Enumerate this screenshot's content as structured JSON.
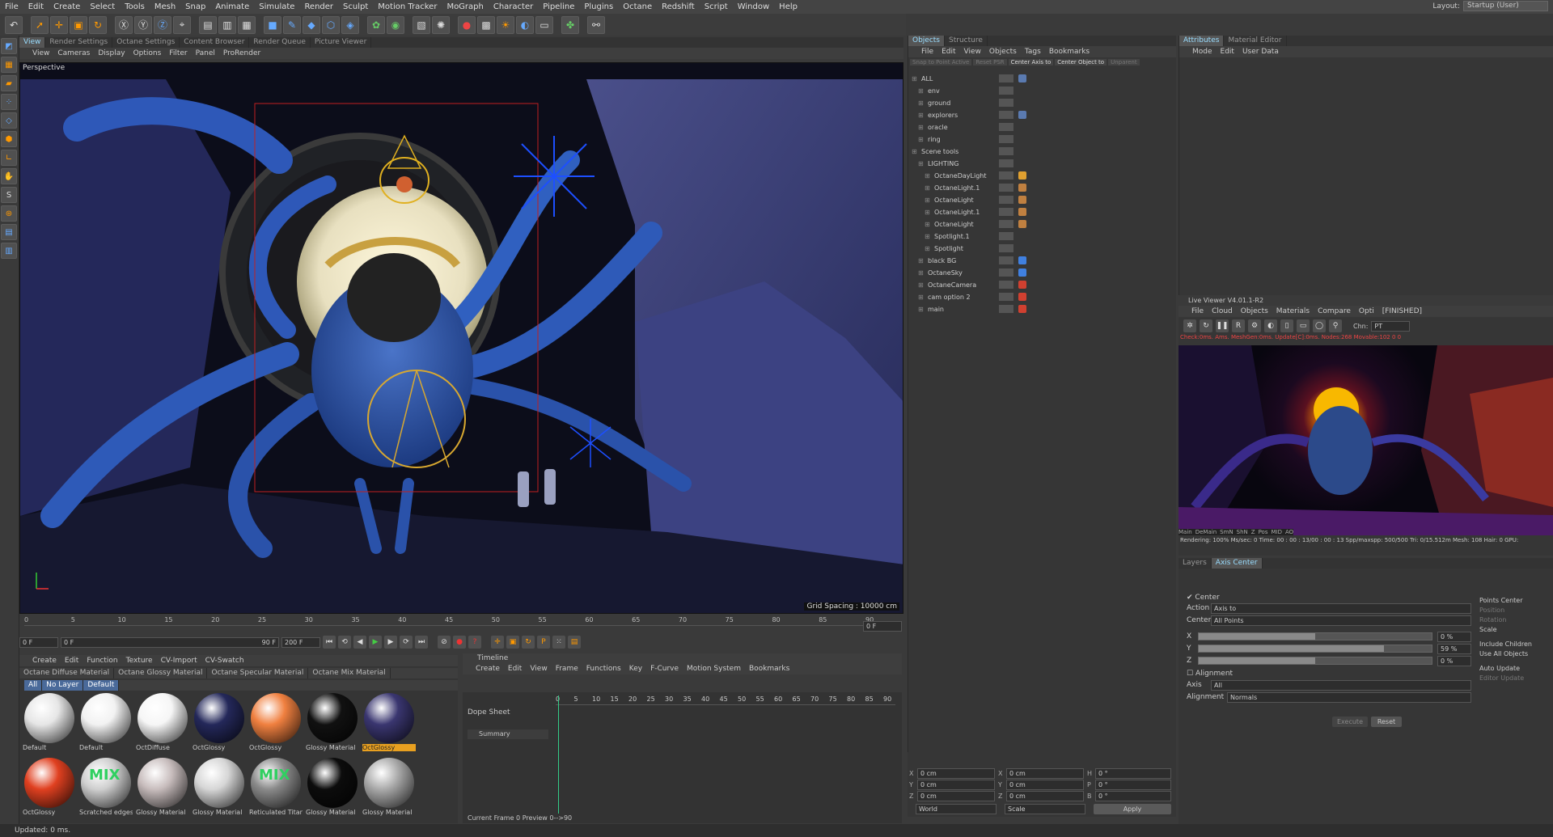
{
  "menu": [
    "File",
    "Edit",
    "Create",
    "Select",
    "Tools",
    "Mesh",
    "Snap",
    "Animate",
    "Simulate",
    "Render",
    "Sculpt",
    "Motion Tracker",
    "MoGraph",
    "Character",
    "Pipeline",
    "Plugins",
    "Octane",
    "Redshift",
    "Script",
    "Window",
    "Help"
  ],
  "layout": {
    "label": "Layout:",
    "value": "Startup (User)"
  },
  "viewport": {
    "tabs": [
      "View",
      "Render Settings",
      "Octane Settings",
      "Content Browser",
      "Render Queue",
      "Picture Viewer"
    ],
    "menu": [
      "View",
      "Cameras",
      "Display",
      "Options",
      "Filter",
      "Panel",
      "ProRender"
    ],
    "label": "Perspective",
    "grid": "Grid Spacing : 10000 cm"
  },
  "timeline": {
    "ticks": [
      "0",
      "5",
      "10",
      "15",
      "20",
      "25",
      "30",
      "35",
      "40",
      "45",
      "50",
      "55",
      "60",
      "65",
      "70",
      "75",
      "80",
      "85",
      "90"
    ],
    "current": "0 F",
    "start": "0 F",
    "preview_start": "0 F",
    "preview_end": "90 F",
    "end": "200 F"
  },
  "materials": {
    "menu": [
      "Create",
      "Edit",
      "Function",
      "Texture",
      "CV-Import",
      "CV-Swatch"
    ],
    "tabs": [
      "Octane Diffuse Material",
      "Octane Glossy Material",
      "Octane Specular Material",
      "Octane Mix Material"
    ],
    "filters": [
      "All",
      "No Layer",
      "Default"
    ],
    "items": [
      {
        "name": "Default",
        "color": "#e6e6e6",
        "mix": ""
      },
      {
        "name": "Default",
        "color": "#f2f2f2",
        "mix": ""
      },
      {
        "name": "OctDiffuse",
        "color": "#f6f6f6",
        "mix": ""
      },
      {
        "name": "OctGlossy",
        "color": "#24285a",
        "mix": ""
      },
      {
        "name": "OctGlossy",
        "color": "#f08040",
        "mix": ""
      },
      {
        "name": "Glossy Material",
        "color": "#111",
        "mix": ""
      },
      {
        "name": "OctGlossy",
        "color": "#3a3670",
        "mix": ""
      },
      {
        "name": "OctGlossy",
        "color": "#e04020",
        "mix": ""
      },
      {
        "name": "Scratched edges",
        "color": "#cfcfcf",
        "mix": "MIX"
      },
      {
        "name": "Glossy Material",
        "color": "#c8bdbd",
        "mix": ""
      },
      {
        "name": "Glossy Material",
        "color": "#d6d6d6",
        "mix": ""
      },
      {
        "name": "Reticulated Titan",
        "color": "#8a8a8a",
        "mix": "MIX"
      },
      {
        "name": "Glossy Material",
        "color": "#0c0c0c",
        "mix": ""
      },
      {
        "name": "Glossy Material",
        "color": "#aaaaaa",
        "mix": ""
      }
    ]
  },
  "dope": {
    "title": "Timeline",
    "menu": [
      "Create",
      "Edit",
      "View",
      "Frame",
      "Functions",
      "Key",
      "F-Curve",
      "Motion System",
      "Bookmarks"
    ],
    "label": "Dope Sheet",
    "summary": "Summary",
    "ticks": [
      "0",
      "5",
      "10",
      "15",
      "20",
      "25",
      "30",
      "35",
      "40",
      "45",
      "50",
      "55",
      "60",
      "65",
      "70",
      "75",
      "80",
      "85",
      "90"
    ],
    "footer": "Current Frame  0  Preview  0-->90"
  },
  "objects": {
    "tabs": [
      "Objects",
      "Structure"
    ],
    "menu": [
      "File",
      "Edit",
      "View",
      "Objects",
      "Tags",
      "Bookmarks"
    ],
    "buttons": [
      "Snap to Point Active",
      "Reset PSR",
      "Center Axis to",
      "Center Object to",
      "Unparent"
    ],
    "rows": [
      {
        "name": "ALL",
        "indent": 0,
        "tag": "#5a7ab0"
      },
      {
        "name": "env",
        "indent": 1,
        "tag": ""
      },
      {
        "name": "ground",
        "indent": 1,
        "tag": ""
      },
      {
        "name": "explorers",
        "indent": 1,
        "tag": "#5a7ab0"
      },
      {
        "name": "oracle",
        "indent": 1,
        "tag": ""
      },
      {
        "name": "ring",
        "indent": 1,
        "tag": ""
      },
      {
        "name": "Scene tools",
        "indent": 0,
        "tag": ""
      },
      {
        "name": "LIGHTING",
        "indent": 1,
        "tag": ""
      },
      {
        "name": "OctaneDayLight",
        "indent": 2,
        "tag": "#e0a030"
      },
      {
        "name": "OctaneLight.1",
        "indent": 2,
        "tag": "#c08040"
      },
      {
        "name": "OctaneLight",
        "indent": 2,
        "tag": "#c08040"
      },
      {
        "name": "OctaneLight.1",
        "indent": 2,
        "tag": "#c08040"
      },
      {
        "name": "OctaneLight",
        "indent": 2,
        "tag": "#c08040"
      },
      {
        "name": "Spotlight.1",
        "indent": 2,
        "tag": ""
      },
      {
        "name": "Spotlight",
        "indent": 2,
        "tag": ""
      },
      {
        "name": "black BG",
        "indent": 1,
        "tag": "#4080e0"
      },
      {
        "name": "OctaneSky",
        "indent": 1,
        "tag": "#4080e0"
      },
      {
        "name": "OctaneCamera",
        "indent": 1,
        "tag": "#d04030"
      },
      {
        "name": "cam option 2",
        "indent": 1,
        "tag": "#d04030"
      },
      {
        "name": "main",
        "indent": 1,
        "tag": "#d04030"
      }
    ]
  },
  "coords": {
    "rows": [
      {
        "a": "X",
        "av": "0 cm",
        "b": "X",
        "bv": "0 cm",
        "c": "H",
        "cv": "0 °"
      },
      {
        "a": "Y",
        "av": "0 cm",
        "b": "Y",
        "bv": "0 cm",
        "c": "P",
        "cv": "0 °"
      },
      {
        "a": "Z",
        "av": "0 cm",
        "b": "Z",
        "bv": "0 cm",
        "c": "B",
        "cv": "0 °"
      }
    ],
    "world": "World",
    "scale": "Scale",
    "apply": "Apply"
  },
  "attributes": {
    "tabs": [
      "Attributes",
      "Material Editor"
    ],
    "menu": [
      "Mode",
      "Edit",
      "User Data"
    ]
  },
  "live": {
    "title": "Live Viewer V4.01.1-R2",
    "menu": [
      "File",
      "Cloud",
      "Objects",
      "Materials",
      "Compare",
      "Opti",
      "[FINISHED]"
    ],
    "chn_label": "Chn:",
    "chn": "PT",
    "info": "Check:0ms. Ams. MeshGen:0ms. Update[C]:0ms. Nodes:268 Movable:102  0 0",
    "passes": [
      "Main",
      "DeMain",
      "SmN",
      "ShN",
      "Z",
      "Pos",
      "MID",
      "AO"
    ],
    "status": "Rendering: 100% Ms/sec: 0   Time: 00 : 00 : 13/00 : 00 : 13  Spp/maxspp: 500/500   Tri: 0/15.512m   Mesh: 108  Hair: 0   GPU:"
  },
  "axis": {
    "tabs": [
      "Layers",
      "Axis Center"
    ],
    "center_label": "Center",
    "action_label": "Action",
    "action": "Axis to",
    "center_sel_label": "Center",
    "center_sel": "All Points",
    "sliders": [
      {
        "axis": "X",
        "value": "0 %",
        "level": 0.5
      },
      {
        "axis": "Y",
        "value": "59 %",
        "level": 0.795
      },
      {
        "axis": "Z",
        "value": "0 %",
        "level": 0.5
      }
    ],
    "right": [
      "Points Center",
      "Position",
      "Rotation",
      "Scale",
      "Include Children",
      "Use All Objects",
      "Auto Update",
      "Editor Update"
    ],
    "alignment_label": "Alignment",
    "axis_label": "Axis",
    "axis_val": "All",
    "align_label": "Alignment",
    "align_val": "Normals",
    "execute": "Execute",
    "reset": "Reset"
  },
  "status": "Updated: 0 ms."
}
